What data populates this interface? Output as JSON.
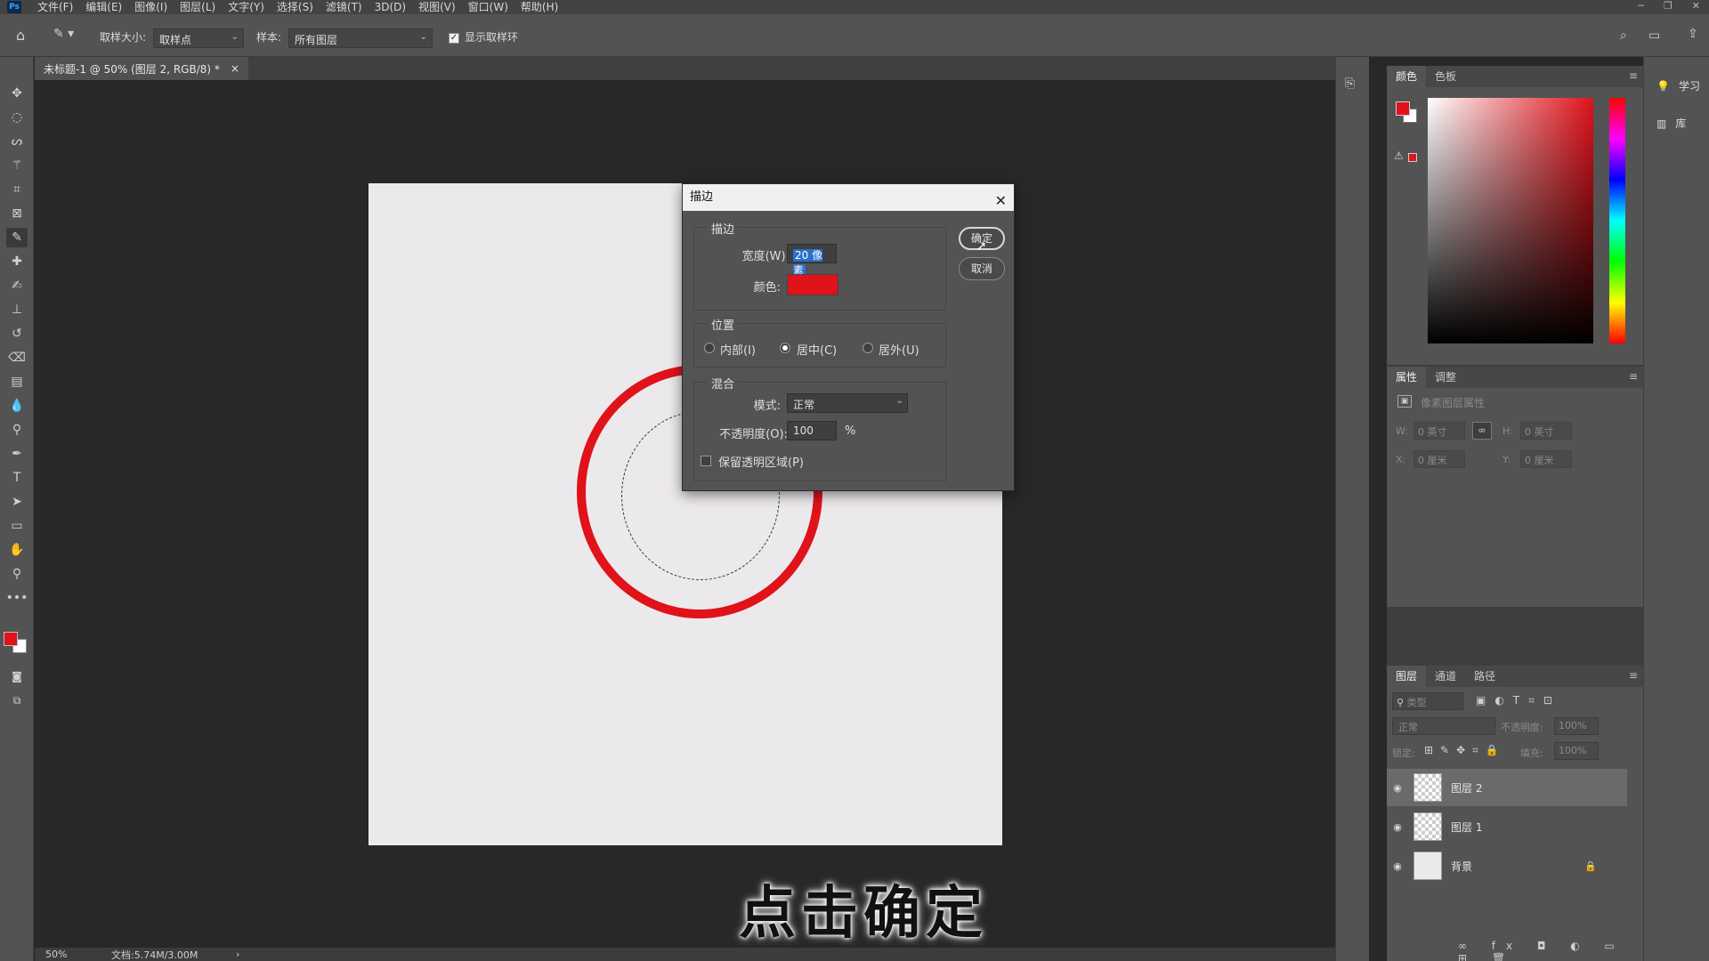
{
  "menubar": {
    "items": [
      "文件(F)",
      "编辑(E)",
      "图像(I)",
      "图层(L)",
      "文字(Y)",
      "选择(S)",
      "滤镜(T)",
      "3D(D)",
      "视图(V)",
      "窗口(W)",
      "帮助(H)"
    ]
  },
  "options": {
    "sample_size_label": "取样大小:",
    "sample_size_value": "取样点",
    "sample_label": "样本:",
    "sample_value": "所有图层",
    "show_ring_label": "显示取样环"
  },
  "document": {
    "tab_title": "未标题-1 @ 50% (图层 2, RGB/8) *",
    "close": "×"
  },
  "status": {
    "zoom": "50%",
    "doc_size": "文档:5.74M/3.00M",
    "arrow": "›"
  },
  "caption": "点击确定",
  "dialog": {
    "title": "描边",
    "stroke_group": "描边",
    "width_label": "宽度(W):",
    "width_value": "20 像素",
    "color_label": "颜色:",
    "stroke_color": "#e0121a",
    "position_group": "位置",
    "positions": [
      "内部(I)",
      "居中(C)",
      "居外(U)"
    ],
    "position_selected": "居中(C)",
    "blend_group": "混合",
    "mode_label": "模式:",
    "mode_value": "正常",
    "opacity_label": "不透明度(O):",
    "opacity_value": "100",
    "opacity_unit": "%",
    "preserve_label": "保留透明区域(P)",
    "ok_label": "确定",
    "cancel_label": "取消"
  },
  "color_panel": {
    "tabs": [
      "颜色",
      "色板"
    ],
    "foreground": "#e0121a",
    "background": "#ffffff"
  },
  "properties_panel": {
    "tabs": [
      "属性",
      "调整"
    ],
    "header": "像素图层属性",
    "w_label": "W:",
    "w_value": "0 英寸",
    "h_label": "H:",
    "h_value": "0 英寸",
    "x_label": "X:",
    "x_value": "0 厘米",
    "y_label": "Y:",
    "y_value": "0 厘米"
  },
  "layers_panel": {
    "tabs": [
      "图层",
      "通道",
      "路径"
    ],
    "filter_placeholder": "类型",
    "blend_mode": "正常",
    "opacity_label": "不透明度:",
    "opacity_value": "100%",
    "lock_label": "锁定:",
    "fill_label": "填充:",
    "fill_value": "100%",
    "layers": [
      {
        "name": "图层 2",
        "selected": true
      },
      {
        "name": "图层 1",
        "selected": false
      },
      {
        "name": "背景",
        "selected": false
      }
    ]
  },
  "far_right": {
    "learn": "学习",
    "library": "库"
  }
}
